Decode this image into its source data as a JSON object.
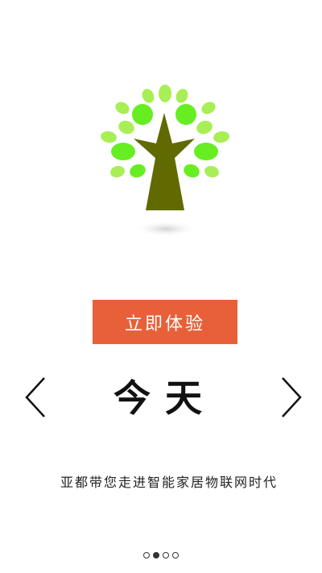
{
  "logo": {
    "icon": "tree-icon"
  },
  "cta": {
    "label": "立即体验"
  },
  "slide": {
    "title": "今天",
    "subtitle": "亚都带您走进智能家居物联网时代"
  },
  "nav": {
    "prev_icon": "chevron-left-icon",
    "next_icon": "chevron-right-icon"
  },
  "pager": {
    "total": 4,
    "active_index": 1
  },
  "colors": {
    "accent": "#e8603a",
    "leaf_dark": "#66ee22",
    "leaf_light": "#a8ee55",
    "trunk": "#606a00"
  }
}
